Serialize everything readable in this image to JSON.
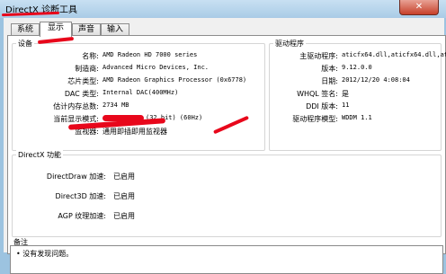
{
  "window": {
    "title": "DirectX 诊断工具",
    "close_glyph": "✕"
  },
  "tabs": [
    {
      "label": "系统",
      "active": false
    },
    {
      "label": "显示",
      "active": true
    },
    {
      "label": "声音",
      "active": false
    },
    {
      "label": "输入",
      "active": false
    }
  ],
  "device": {
    "title": "设备",
    "rows": [
      {
        "label": "名称:",
        "value": "AMD Radeon HD 7000 series"
      },
      {
        "label": "制造商:",
        "value": "Advanced Micro Devices, Inc."
      },
      {
        "label": "芯片类型:",
        "value": "AMD Radeon Graphics Processor (0x6778)"
      },
      {
        "label": "DAC 类型:",
        "value": "Internal DAC(400MHz)"
      },
      {
        "label": "估计内存总数:",
        "value": "2734 MB"
      },
      {
        "label": "当前显示模式:",
        "value": "(32 bit) (60Hz)"
      },
      {
        "label": "监视器:",
        "value": "通用即插即用监视器"
      }
    ]
  },
  "driver": {
    "title": "驱动程序",
    "rows": [
      {
        "label": "主驱动程序:",
        "value": "aticfx64.dll,aticfx64.dll,atic"
      },
      {
        "label": "版本:",
        "value": "9.12.0.0"
      },
      {
        "label": "日期:",
        "value": "2012/12/20 4:08:04"
      },
      {
        "label": "WHQL 签名:",
        "value": "是"
      },
      {
        "label": "DDI 版本:",
        "value": "11"
      },
      {
        "label": "驱动程序模型:",
        "value": "WDDM 1.1"
      }
    ]
  },
  "directx": {
    "title": "DirectX 功能",
    "rows": [
      {
        "label": "DirectDraw 加速:",
        "value": "已启用"
      },
      {
        "label": "Direct3D 加速:",
        "value": "已启用"
      },
      {
        "label": "AGP 纹理加速:",
        "value": "已启用"
      }
    ]
  },
  "notes": {
    "title": "备注",
    "items": [
      "没有发现问题。"
    ]
  }
}
